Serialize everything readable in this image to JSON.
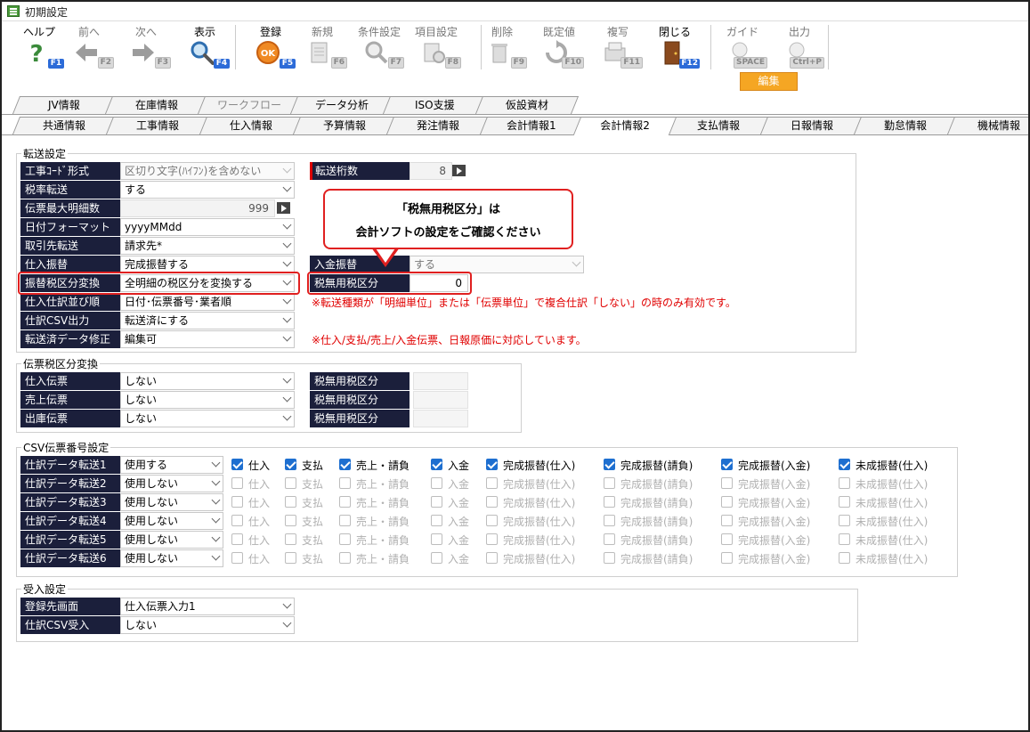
{
  "window": {
    "title": "初期設定"
  },
  "toolbar": [
    {
      "label": "ヘルプ",
      "key": "F1",
      "icon": "help-icon",
      "enabled": true
    },
    {
      "label": "前へ",
      "key": "F2",
      "icon": "arrow-left-icon",
      "enabled": false
    },
    {
      "label": "次へ",
      "key": "F3",
      "icon": "arrow-right-icon",
      "enabled": false
    },
    {
      "label": "表示",
      "key": "F4",
      "icon": "magnifier-icon",
      "enabled": true
    },
    {
      "label": "登録",
      "key": "F5",
      "icon": "ok-icon",
      "enabled": true
    },
    {
      "label": "新規",
      "key": "F6",
      "icon": "new-document-icon",
      "enabled": false
    },
    {
      "label": "条件設定",
      "key": "F7",
      "icon": "condition-search-icon",
      "enabled": false
    },
    {
      "label": "項目設定",
      "key": "F8",
      "icon": "item-settings-icon",
      "enabled": false
    },
    {
      "label": "削除",
      "key": "F9",
      "icon": "trash-icon",
      "enabled": false
    },
    {
      "label": "既定値",
      "key": "F10",
      "icon": "reset-icon",
      "enabled": false
    },
    {
      "label": "複写",
      "key": "F11",
      "icon": "copy-icon",
      "enabled": false
    },
    {
      "label": "閉じる",
      "key": "F12",
      "icon": "door-exit-icon",
      "enabled": true
    },
    {
      "label": "ガイド",
      "key": "SPACE",
      "icon": "lightbulb-icon",
      "enabled": false
    },
    {
      "label": "出力",
      "key": "Ctrl+P",
      "icon": "output-icon",
      "enabled": false
    }
  ],
  "mode_badge": "編集",
  "top_tabs": [
    "JV情報",
    "在庫情報",
    "ワークフロー",
    "データ分析",
    "ISO支援",
    "仮設資材"
  ],
  "top_tabs_disabled": [
    false,
    false,
    true,
    false,
    false,
    false
  ],
  "sub_tabs": [
    "共通情報",
    "工事情報",
    "仕入情報",
    "予算情報",
    "発注情報",
    "会計情報1",
    "会計情報2",
    "支払情報",
    "日報情報",
    "勤怠情報",
    "機械情報"
  ],
  "active_sub_tab": "会計情報2",
  "transfer": {
    "title": "転送設定",
    "rows": [
      {
        "label": "工事ｺｰﾄﾞ形式",
        "value": "区切り文字(ﾊｲﾌﾝ)を含めない",
        "disabled": true
      },
      {
        "label": "税率転送",
        "value": "する"
      },
      {
        "label": "伝票最大明細数",
        "value": "999"
      },
      {
        "label": "日付フォーマット",
        "value": "yyyyMMdd"
      },
      {
        "label": "取引先転送",
        "value": "請求先*"
      },
      {
        "label": "仕入振替",
        "value": "完成振替する"
      },
      {
        "label": "振替税区分変換",
        "value": "全明細の税区分を変換する"
      },
      {
        "label": "仕入仕訳並び順",
        "value": "日付･伝票番号･業者順"
      },
      {
        "label": "仕訳CSV出力",
        "value": "転送済にする"
      },
      {
        "label": "転送済データ修正",
        "value": "編集可"
      }
    ],
    "digits": {
      "label": "転送桁数",
      "value": "8"
    },
    "deposit": {
      "label": "入金振替",
      "value": "する"
    },
    "tax_free": {
      "label": "税無用税区分",
      "value": "0"
    },
    "note1": "※転送種類が「明細単位」または「伝票単位」で複合仕訳「しない」の時のみ有効です。",
    "note2": "※仕入/支払/売上/入金伝票、日報原価に対応しています。"
  },
  "callout": {
    "line1": "「税無用税区分」は",
    "line2": "会計ソフトの設定をご確認ください"
  },
  "slip_tax": {
    "title": "伝票税区分変換",
    "rows": [
      {
        "label": "仕入伝票",
        "value": "しない",
        "right_label": "税無用税区分"
      },
      {
        "label": "売上伝票",
        "value": "しない",
        "right_label": "税無用税区分"
      },
      {
        "label": "出庫伝票",
        "value": "しない",
        "right_label": "税無用税区分"
      }
    ]
  },
  "csv_numbers": {
    "title": "CSV伝票番号設定",
    "checkbox_labels": [
      "仕入",
      "支払",
      "売上・請負",
      "入金",
      "完成振替(仕入)",
      "完成振替(請負)",
      "完成振替(入金)",
      "未成振替(仕入)"
    ],
    "rows": [
      {
        "label": "仕訳データ転送1",
        "value": "使用する",
        "checked": true
      },
      {
        "label": "仕訳データ転送2",
        "value": "使用しない",
        "checked": false
      },
      {
        "label": "仕訳データ転送3",
        "value": "使用しない",
        "checked": false
      },
      {
        "label": "仕訳データ転送4",
        "value": "使用しない",
        "checked": false
      },
      {
        "label": "仕訳データ転送5",
        "value": "使用しない",
        "checked": false
      },
      {
        "label": "仕訳データ転送6",
        "value": "使用しない",
        "checked": false
      }
    ]
  },
  "receive": {
    "title": "受入設定",
    "rows": [
      {
        "label": "登録先画面",
        "value": "仕入伝票入力1"
      },
      {
        "label": "仕訳CSV受入",
        "value": "しない"
      }
    ]
  },
  "colors": {
    "label_bg": "#1b1f3b",
    "accent_blue": "#2c6bd8",
    "highlight_red": "#e02020",
    "badge_orange": "#f5a623"
  }
}
